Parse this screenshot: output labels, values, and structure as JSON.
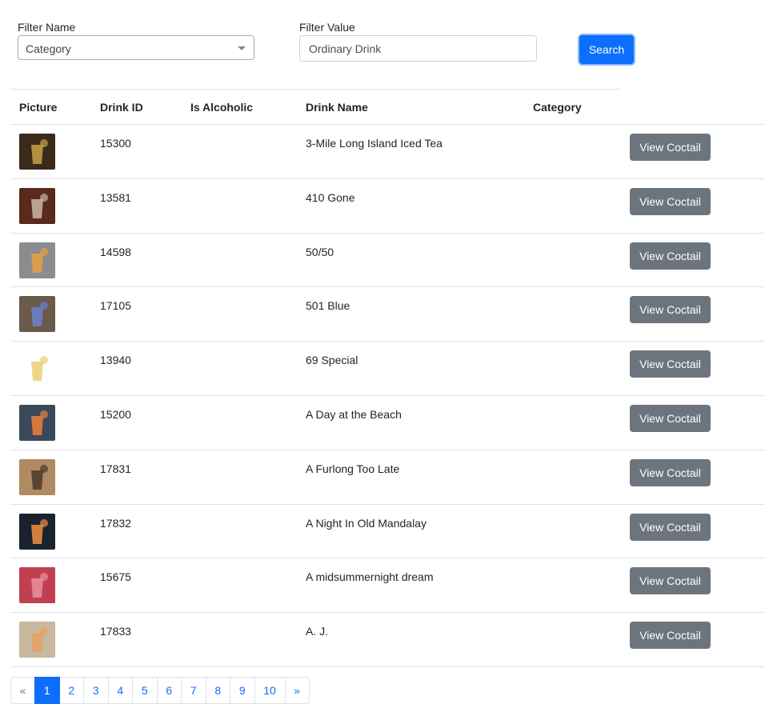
{
  "filters": {
    "name_label": "Filter Name",
    "name_selected": "Category",
    "value_label": "Filter Value",
    "value_current": "Ordinary Drink",
    "search_label": "Search"
  },
  "table": {
    "headers": {
      "picture": "Picture",
      "drink_id": "Drink ID",
      "is_alcoholic": "Is Alcoholic",
      "drink_name": "Drink Name",
      "category": "Category"
    },
    "rows": [
      {
        "id": "15300",
        "alcoholic": "",
        "name": "3-Mile Long Island Iced Tea",
        "category": "",
        "action": "View Coctail",
        "thumb_colors": [
          "#3a2a1a",
          "#c9a24a"
        ]
      },
      {
        "id": "13581",
        "alcoholic": "",
        "name": "410 Gone",
        "category": "",
        "action": "View Coctail",
        "thumb_colors": [
          "#5a2a1c",
          "#c9b8a8"
        ]
      },
      {
        "id": "14598",
        "alcoholic": "",
        "name": "50/50",
        "category": "",
        "action": "View Coctail",
        "thumb_colors": [
          "#8a8c90",
          "#e8a040"
        ]
      },
      {
        "id": "17105",
        "alcoholic": "",
        "name": "501 Blue",
        "category": "",
        "action": "View Coctail",
        "thumb_colors": [
          "#6a5a4a",
          "#6a80d0"
        ]
      },
      {
        "id": "13940",
        "alcoholic": "",
        "name": "69 Special",
        "category": "",
        "action": "View Coctail",
        "thumb_colors": [
          "#ffffff",
          "#e8d070"
        ]
      },
      {
        "id": "15200",
        "alcoholic": "",
        "name": "A Day at the Beach",
        "category": "",
        "action": "View Coctail",
        "thumb_colors": [
          "#3a4a5a",
          "#f0803a"
        ]
      },
      {
        "id": "17831",
        "alcoholic": "",
        "name": "A Furlong Too Late",
        "category": "",
        "action": "View Coctail",
        "thumb_colors": [
          "#b08a60",
          "#4a3a2a"
        ]
      },
      {
        "id": "17832",
        "alcoholic": "",
        "name": "A Night In Old Mandalay",
        "category": "",
        "action": "View Coctail",
        "thumb_colors": [
          "#1a2230",
          "#f09040"
        ]
      },
      {
        "id": "15675",
        "alcoholic": "",
        "name": "A midsummernight dream",
        "category": "",
        "action": "View Coctail",
        "thumb_colors": [
          "#c04050",
          "#e890a0"
        ]
      },
      {
        "id": "17833",
        "alcoholic": "",
        "name": "A. J.",
        "category": "",
        "action": "View Coctail",
        "thumb_colors": [
          "#c8b8a0",
          "#e8a060"
        ]
      }
    ]
  },
  "pagination": {
    "prev": "«",
    "pages": [
      "1",
      "2",
      "3",
      "4",
      "5",
      "6",
      "7",
      "8",
      "9",
      "10"
    ],
    "next": "»",
    "active_page": "1"
  }
}
